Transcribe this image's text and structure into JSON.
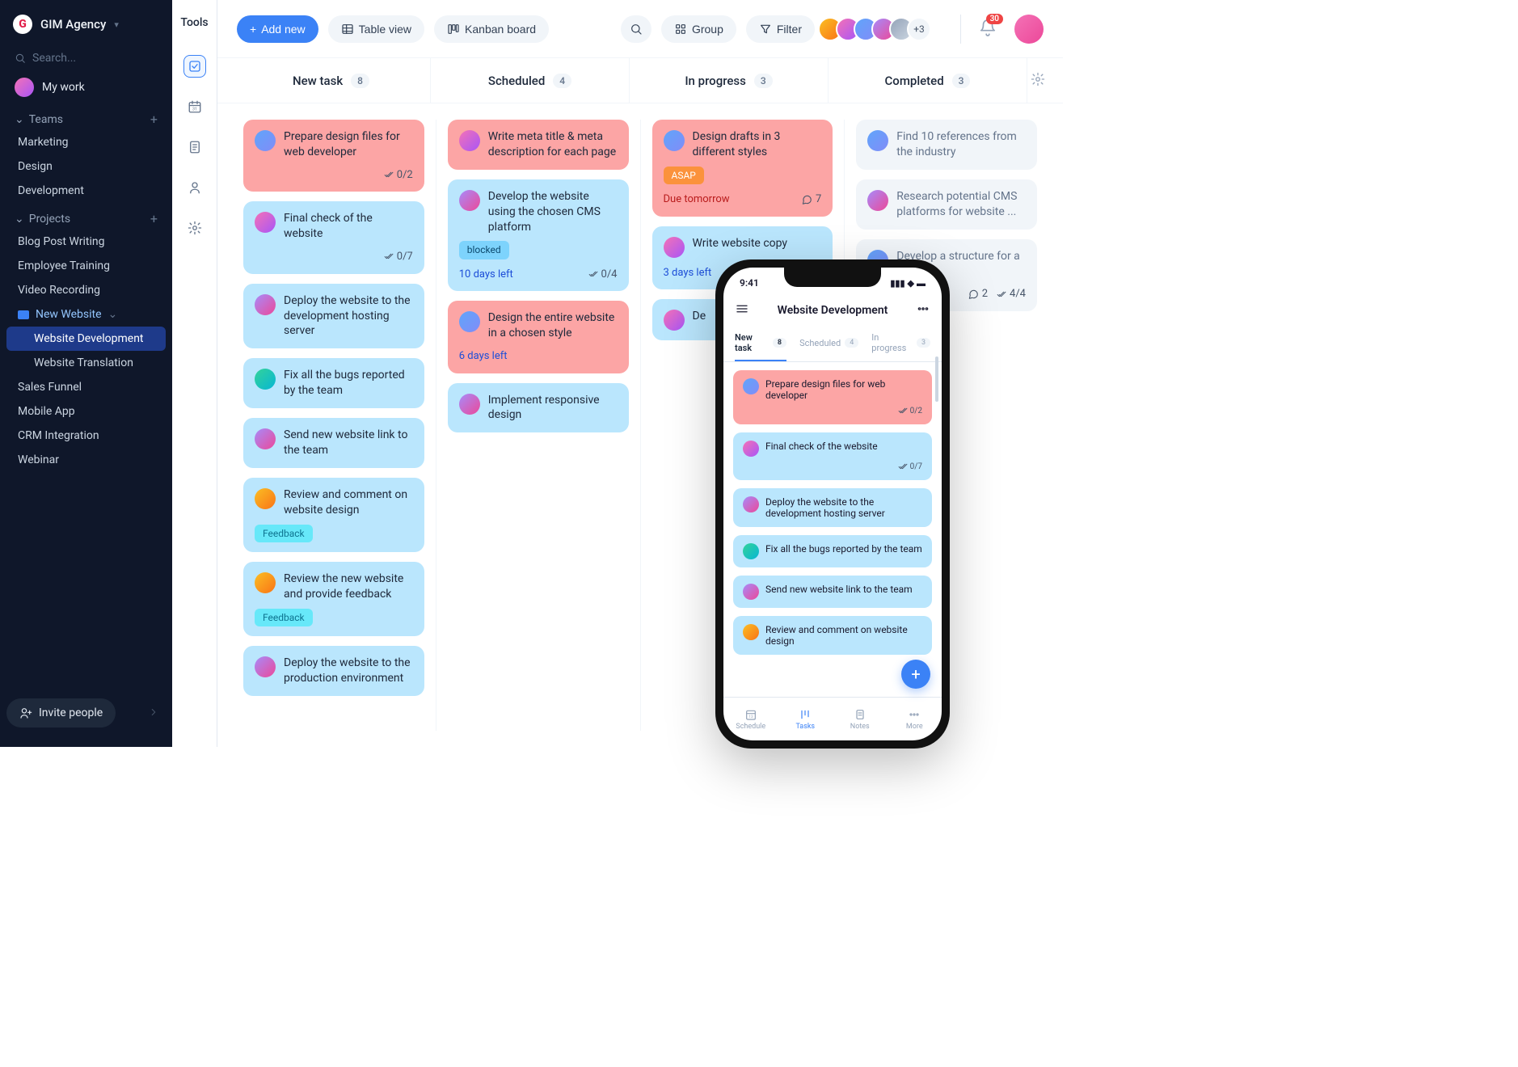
{
  "brand": {
    "name": "GIM Agency",
    "logo_letter": "G"
  },
  "search": {
    "placeholder": "Search..."
  },
  "my_work": {
    "label": "My work"
  },
  "sections": {
    "teams": {
      "label": "Teams",
      "items": [
        "Marketing",
        "Design",
        "Development"
      ]
    },
    "projects": {
      "label": "Projects",
      "items": [
        "Blog Post Writing",
        "Employee Training",
        "Video Recording"
      ],
      "folder": {
        "name": "New Website",
        "children": [
          "Website Development",
          "Website Translation"
        ],
        "active_index": 0
      },
      "items_after": [
        "Sales Funnel",
        "Mobile App",
        "CRM Integration",
        "Webinar"
      ]
    }
  },
  "invite": {
    "label": "Invite people"
  },
  "tool_rail": {
    "label": "Tools"
  },
  "topbar": {
    "add_new": "Add new",
    "table_view": "Table view",
    "kanban": "Kanban board",
    "group": "Group",
    "filter": "Filter",
    "more_avatars": "+3",
    "notifications": "30"
  },
  "columns": [
    {
      "title": "New task",
      "count": "8"
    },
    {
      "title": "Scheduled",
      "count": "4"
    },
    {
      "title": "In progress",
      "count": "3"
    },
    {
      "title": "Completed",
      "count": "3"
    }
  ],
  "cards": {
    "new_task": [
      {
        "title": "Prepare design files for web developer",
        "color": "salmon",
        "check": "0/2",
        "avatar": "a2"
      },
      {
        "title": "Final check of the website",
        "color": "sky",
        "check": "0/7",
        "avatar": "a1"
      },
      {
        "title": "Deploy the website to the development hosting server",
        "color": "sky",
        "avatar": "a5"
      },
      {
        "title": "Fix all the bugs reported by the team",
        "color": "sky",
        "avatar": "a4"
      },
      {
        "title": "Send new website link to the team",
        "color": "sky",
        "avatar": "a5"
      },
      {
        "title": "Review and comment on website design",
        "color": "sky",
        "tag": "Feedback",
        "tag_class": "feedback",
        "avatar": "a3"
      },
      {
        "title": "Review the new website and provide feedback",
        "color": "sky",
        "tag": "Feedback",
        "tag_class": "feedback",
        "avatar": "a3"
      },
      {
        "title": "Deploy the website to the production environment",
        "color": "sky",
        "avatar": "a5"
      }
    ],
    "scheduled": [
      {
        "title": "Write meta title & meta description for each page",
        "color": "salmon",
        "avatar": "a1"
      },
      {
        "title": "Develop the website using the chosen CMS platform",
        "color": "sky",
        "tag": "blocked",
        "tag_class": "blocked",
        "due": "10 days left",
        "check": "0/4",
        "avatar": "a5"
      },
      {
        "title": "Design the entire website in a chosen style",
        "color": "salmon",
        "due": "6 days left",
        "avatar": "a2"
      },
      {
        "title": "Implement responsive design",
        "color": "sky",
        "avatar": "a5"
      }
    ],
    "in_progress": [
      {
        "title": "Design drafts in 3 different styles",
        "color": "salmon",
        "tag": "ASAP",
        "tag_class": "asap",
        "due": "Due tomorrow",
        "due_class": "red",
        "comments": "7",
        "avatar": "a2"
      },
      {
        "title": "Write website copy",
        "color": "sky",
        "due": "3 days left",
        "avatar": "a1"
      },
      {
        "title": "De",
        "color": "sky",
        "avatar": "a1"
      }
    ],
    "completed": [
      {
        "title": "Find 10 references from the industry",
        "avatar": "a2"
      },
      {
        "title": "Research potential CMS platforms for website ...",
        "avatar": "a5"
      },
      {
        "title": "Develop a structure for a website",
        "avatar": "a2",
        "comments": "2",
        "check": "4/4"
      }
    ]
  },
  "phone": {
    "time": "9:41",
    "title": "Website Development",
    "tabs": [
      {
        "label": "New task",
        "count": "8"
      },
      {
        "label": "Scheduled",
        "count": "4"
      },
      {
        "label": "In progress",
        "count": "3"
      }
    ],
    "cards": [
      {
        "title": "Prepare design files for web developer",
        "color": "salmon",
        "check": "0/2",
        "avatar": "a2"
      },
      {
        "title": "Final check of the website",
        "color": "sky",
        "check": "0/7",
        "avatar": "a1"
      },
      {
        "title": "Deploy the website to the development hosting server",
        "color": "sky",
        "avatar": "a5"
      },
      {
        "title": "Fix all the bugs reported by the team",
        "color": "sky",
        "avatar": "a4"
      },
      {
        "title": "Send new website link to the team",
        "color": "sky",
        "avatar": "a5"
      },
      {
        "title": "Review and comment on website design",
        "color": "sky",
        "avatar": "a3"
      }
    ],
    "nav": [
      "Schedule",
      "Tasks",
      "Notes",
      "More"
    ]
  }
}
